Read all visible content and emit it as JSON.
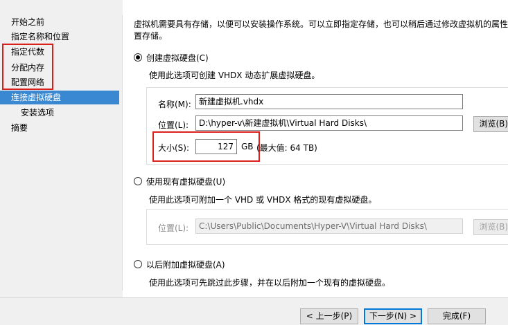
{
  "nav": {
    "items": [
      {
        "label": "开始之前"
      },
      {
        "label": "指定名称和位置"
      },
      {
        "label": "指定代数"
      },
      {
        "label": "分配内存"
      },
      {
        "label": "配置网络"
      },
      {
        "label": "连接虚拟硬盘",
        "active": true
      },
      {
        "label": "安装选项",
        "sub": true
      },
      {
        "label": "摘要"
      }
    ]
  },
  "intro": {
    "line1": "虚拟机需要具有存储，以便可以安装操作系统。可以立即指定存储，也可以稍后通过修改虚拟机的属性来",
    "line2": "置存储。"
  },
  "option_create": {
    "label": "创建虚拟硬盘(C)",
    "selected": true,
    "description": "使用此选项可创建 VHDX 动态扩展虚拟硬盘。",
    "name_label": "名称(M):",
    "name_value": "新建虚拟机.vhdx",
    "location_label": "位置(L):",
    "location_value": "D:\\hyper-v\\新建虚拟机\\Virtual Hard Disks\\",
    "browse_label": "浏览(B)...",
    "size_label": "大小(S):",
    "size_value": "127",
    "size_unit": "GB",
    "size_max": "(最大值: 64 TB)"
  },
  "option_existing": {
    "label": "使用现有虚拟硬盘(U)",
    "selected": false,
    "description": "使用此选项可附加一个 VHD 或 VHDX 格式的现有虚拟硬盘。",
    "location_label": "位置(L):",
    "location_value": "C:\\Users\\Public\\Documents\\Hyper-V\\Virtual Hard Disks\\",
    "browse_label": "浏览(B)..."
  },
  "option_later": {
    "label": "以后附加虚拟硬盘(A)",
    "selected": false,
    "description": "使用此选项可先跳过此步骤，并在以后附加一个现有的虚拟硬盘。"
  },
  "footer": {
    "prev": "< 上一步(P)",
    "next": "下一步(N) >",
    "finish": "完成(F)"
  },
  "colors": {
    "accent": "#3a88d1",
    "highlight": "#d9201c"
  }
}
